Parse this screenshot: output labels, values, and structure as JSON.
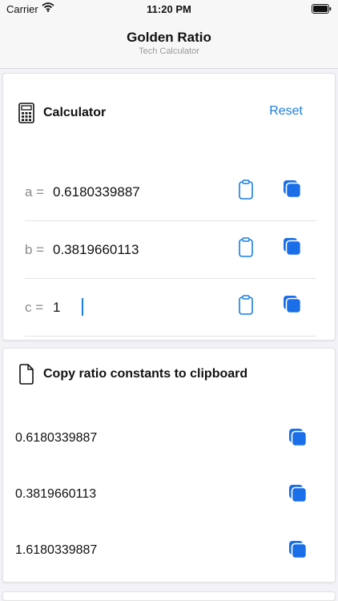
{
  "status_bar": {
    "carrier": "Carrier",
    "time": "11:20 PM"
  },
  "nav": {
    "title": "Golden Ratio",
    "subtitle": "Tech Calculator"
  },
  "calculator": {
    "title": "Calculator",
    "reset_label": "Reset",
    "rows": [
      {
        "label": "a =",
        "value": "0.6180339887"
      },
      {
        "label": "b =",
        "value": "0.3819660113"
      },
      {
        "label": "c =",
        "value": "1"
      }
    ]
  },
  "constants": {
    "title": "Copy ratio constants to clipboard",
    "items": [
      {
        "value": "0.6180339887"
      },
      {
        "value": "0.3819660113"
      },
      {
        "value": "1.6180339887"
      }
    ]
  },
  "colors": {
    "accent": "#1a7ee0",
    "copy_fill": "#1a6fe8"
  },
  "icons": {
    "calculator": "calculator-icon",
    "document": "document-icon",
    "paste": "clipboard-icon",
    "copy": "copy-icon"
  }
}
